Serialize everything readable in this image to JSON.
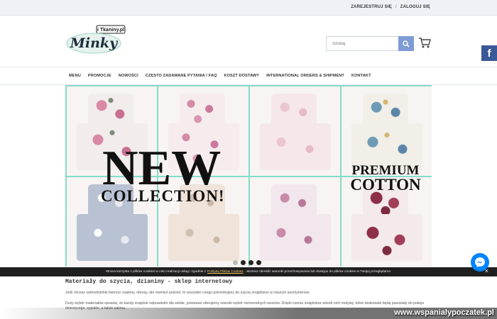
{
  "topbar": {
    "register": "ZAREJESTRUJ SIĘ",
    "separator": "/",
    "login": "ZALOGUJ SIĘ"
  },
  "logo": {
    "top": "i Tkaniny.pl",
    "main": "Minky"
  },
  "search": {
    "placeholder": "Szukaj"
  },
  "facebook": {
    "glyph": "f"
  },
  "nav": [
    "MENU",
    "PROMOCJE",
    "NOWOŚCI",
    "CZĘSTO ZADAWANE PYTANIA / FAQ",
    "KOSZT DOSTAWY",
    "INTERNATIONAL ORDERS & SHIPMENT",
    "KONTAKT"
  ],
  "slider": {
    "headline": "NEW",
    "subheadline": "COLLECTION!",
    "badge_line1": "PREMIUM",
    "badge_line2": "COTTON",
    "accent_color": "#85ddc8",
    "tiles": [
      "floral",
      "pink",
      "blush",
      "blue",
      "grey",
      "beige",
      "lilac",
      "plum"
    ],
    "dots": 4,
    "active_dot": 0
  },
  "content": {
    "heading": "Materiały do szycia, dzianiny - sklep internetowy",
    "p1": "Jeśli chcesz samodzielnie tworzyć zasłony, obrusy, ale również pościel, to wszystko czego potrzebujesz do szycia znajdziesz w naszym asortymencie.",
    "p2": "Duży wybór materiałów sprawia, że każdy znajdzie odpowiedni dla siebie, ponieważ oferujemy szeroki wybór różnorodnych wzorów. Dzięki czemu znajdziesz wśród nich motywy, które doskonale będą pasowały do pokoju dziecięcego, sypialni, a także salonu."
  },
  "cookie": {
    "text_before": "Strona korzysta z plików cookies w celu realizacji usług i zgodnie z",
    "link": "Polityką Plików Cookies",
    "text_after": ". Możesz określić warunki przechowywania lub dostępu do plików cookies w Twojej przeglądarce.",
    "close": "✕"
  },
  "watermark": "www.wspanialypoczatek.pl"
}
